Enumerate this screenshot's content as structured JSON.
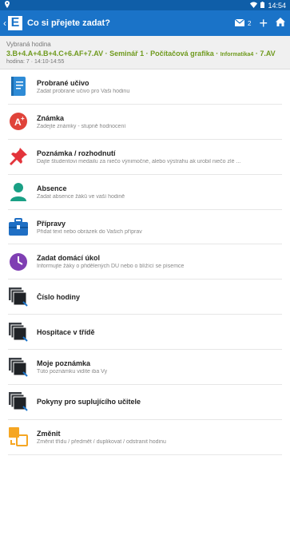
{
  "statusbar": {
    "time": "14:54"
  },
  "appbar": {
    "back": "‹",
    "logo": "E",
    "title": "Co si přejete zadat?",
    "mail_count": "2",
    "plus": "+"
  },
  "selected": {
    "caption": "Vybraná hodina",
    "title_main": "3.B+4.A+4.B+4.C+6.AF+7.AV · Seminář 1 · Počítačová grafika · ",
    "title_small": "Informatika4",
    "title_end": " · 7.AV",
    "time": "hodina: 7 · 14:10-14:55"
  },
  "items": [
    {
      "label": "Probrané učivo",
      "sub": "Zadat probrané učivo pro Vaši hodinu"
    },
    {
      "label": "Známka",
      "sub": "Zadejte známky - stupně hodnocení"
    },
    {
      "label": "Poznámka / rozhodnutí",
      "sub": "Dajte študentovi medailu za niečo výnimočné, alebo výstrahu ak urobil niečo zlé ..."
    },
    {
      "label": "Absence",
      "sub": "Zadat absence žáků ve vaší hodině"
    },
    {
      "label": "Přípravy",
      "sub": "Přidat text nebo obrázek do Vašich příprav"
    },
    {
      "label": "Zadat domácí úkol",
      "sub": "Informujte žáky o přidělených DÚ nebo o blížící se písemce"
    },
    {
      "label": "Číslo hodiny",
      "sub": ""
    },
    {
      "label": "Hospitace v třídě",
      "sub": ""
    },
    {
      "label": "Moje poznámka",
      "sub": "Túto poznámku vidíte iba Vy"
    },
    {
      "label": "Pokyny pro suplujícího učitele",
      "sub": ""
    },
    {
      "label": "Změnit",
      "sub": "Změnit třídu / předmět / duplikovat / odstranit hodinu"
    }
  ],
  "icons": [
    "notebook-icon",
    "grade-icon",
    "pin-icon",
    "person-icon",
    "briefcase-icon",
    "clock-icon",
    "stack-icon",
    "stack-icon",
    "stack-icon",
    "stack-icon",
    "swap-icon"
  ],
  "colors": {
    "appbar": "#1a73c8",
    "statusbar": "#0f5ea8",
    "selected_title": "#6f9a1e"
  }
}
